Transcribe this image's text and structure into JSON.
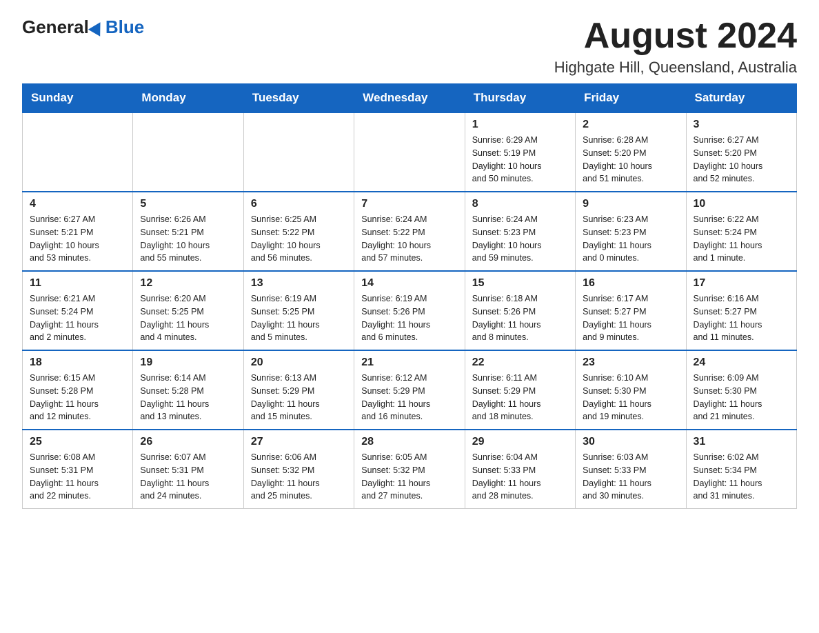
{
  "header": {
    "logo_general": "General",
    "logo_blue": "Blue",
    "month_title": "August 2024",
    "location": "Highgate Hill, Queensland, Australia"
  },
  "days_of_week": [
    "Sunday",
    "Monday",
    "Tuesday",
    "Wednesday",
    "Thursday",
    "Friday",
    "Saturday"
  ],
  "weeks": [
    [
      {
        "day": "",
        "info": ""
      },
      {
        "day": "",
        "info": ""
      },
      {
        "day": "",
        "info": ""
      },
      {
        "day": "",
        "info": ""
      },
      {
        "day": "1",
        "info": "Sunrise: 6:29 AM\nSunset: 5:19 PM\nDaylight: 10 hours\nand 50 minutes."
      },
      {
        "day": "2",
        "info": "Sunrise: 6:28 AM\nSunset: 5:20 PM\nDaylight: 10 hours\nand 51 minutes."
      },
      {
        "day": "3",
        "info": "Sunrise: 6:27 AM\nSunset: 5:20 PM\nDaylight: 10 hours\nand 52 minutes."
      }
    ],
    [
      {
        "day": "4",
        "info": "Sunrise: 6:27 AM\nSunset: 5:21 PM\nDaylight: 10 hours\nand 53 minutes."
      },
      {
        "day": "5",
        "info": "Sunrise: 6:26 AM\nSunset: 5:21 PM\nDaylight: 10 hours\nand 55 minutes."
      },
      {
        "day": "6",
        "info": "Sunrise: 6:25 AM\nSunset: 5:22 PM\nDaylight: 10 hours\nand 56 minutes."
      },
      {
        "day": "7",
        "info": "Sunrise: 6:24 AM\nSunset: 5:22 PM\nDaylight: 10 hours\nand 57 minutes."
      },
      {
        "day": "8",
        "info": "Sunrise: 6:24 AM\nSunset: 5:23 PM\nDaylight: 10 hours\nand 59 minutes."
      },
      {
        "day": "9",
        "info": "Sunrise: 6:23 AM\nSunset: 5:23 PM\nDaylight: 11 hours\nand 0 minutes."
      },
      {
        "day": "10",
        "info": "Sunrise: 6:22 AM\nSunset: 5:24 PM\nDaylight: 11 hours\nand 1 minute."
      }
    ],
    [
      {
        "day": "11",
        "info": "Sunrise: 6:21 AM\nSunset: 5:24 PM\nDaylight: 11 hours\nand 2 minutes."
      },
      {
        "day": "12",
        "info": "Sunrise: 6:20 AM\nSunset: 5:25 PM\nDaylight: 11 hours\nand 4 minutes."
      },
      {
        "day": "13",
        "info": "Sunrise: 6:19 AM\nSunset: 5:25 PM\nDaylight: 11 hours\nand 5 minutes."
      },
      {
        "day": "14",
        "info": "Sunrise: 6:19 AM\nSunset: 5:26 PM\nDaylight: 11 hours\nand 6 minutes."
      },
      {
        "day": "15",
        "info": "Sunrise: 6:18 AM\nSunset: 5:26 PM\nDaylight: 11 hours\nand 8 minutes."
      },
      {
        "day": "16",
        "info": "Sunrise: 6:17 AM\nSunset: 5:27 PM\nDaylight: 11 hours\nand 9 minutes."
      },
      {
        "day": "17",
        "info": "Sunrise: 6:16 AM\nSunset: 5:27 PM\nDaylight: 11 hours\nand 11 minutes."
      }
    ],
    [
      {
        "day": "18",
        "info": "Sunrise: 6:15 AM\nSunset: 5:28 PM\nDaylight: 11 hours\nand 12 minutes."
      },
      {
        "day": "19",
        "info": "Sunrise: 6:14 AM\nSunset: 5:28 PM\nDaylight: 11 hours\nand 13 minutes."
      },
      {
        "day": "20",
        "info": "Sunrise: 6:13 AM\nSunset: 5:29 PM\nDaylight: 11 hours\nand 15 minutes."
      },
      {
        "day": "21",
        "info": "Sunrise: 6:12 AM\nSunset: 5:29 PM\nDaylight: 11 hours\nand 16 minutes."
      },
      {
        "day": "22",
        "info": "Sunrise: 6:11 AM\nSunset: 5:29 PM\nDaylight: 11 hours\nand 18 minutes."
      },
      {
        "day": "23",
        "info": "Sunrise: 6:10 AM\nSunset: 5:30 PM\nDaylight: 11 hours\nand 19 minutes."
      },
      {
        "day": "24",
        "info": "Sunrise: 6:09 AM\nSunset: 5:30 PM\nDaylight: 11 hours\nand 21 minutes."
      }
    ],
    [
      {
        "day": "25",
        "info": "Sunrise: 6:08 AM\nSunset: 5:31 PM\nDaylight: 11 hours\nand 22 minutes."
      },
      {
        "day": "26",
        "info": "Sunrise: 6:07 AM\nSunset: 5:31 PM\nDaylight: 11 hours\nand 24 minutes."
      },
      {
        "day": "27",
        "info": "Sunrise: 6:06 AM\nSunset: 5:32 PM\nDaylight: 11 hours\nand 25 minutes."
      },
      {
        "day": "28",
        "info": "Sunrise: 6:05 AM\nSunset: 5:32 PM\nDaylight: 11 hours\nand 27 minutes."
      },
      {
        "day": "29",
        "info": "Sunrise: 6:04 AM\nSunset: 5:33 PM\nDaylight: 11 hours\nand 28 minutes."
      },
      {
        "day": "30",
        "info": "Sunrise: 6:03 AM\nSunset: 5:33 PM\nDaylight: 11 hours\nand 30 minutes."
      },
      {
        "day": "31",
        "info": "Sunrise: 6:02 AM\nSunset: 5:34 PM\nDaylight: 11 hours\nand 31 minutes."
      }
    ]
  ]
}
